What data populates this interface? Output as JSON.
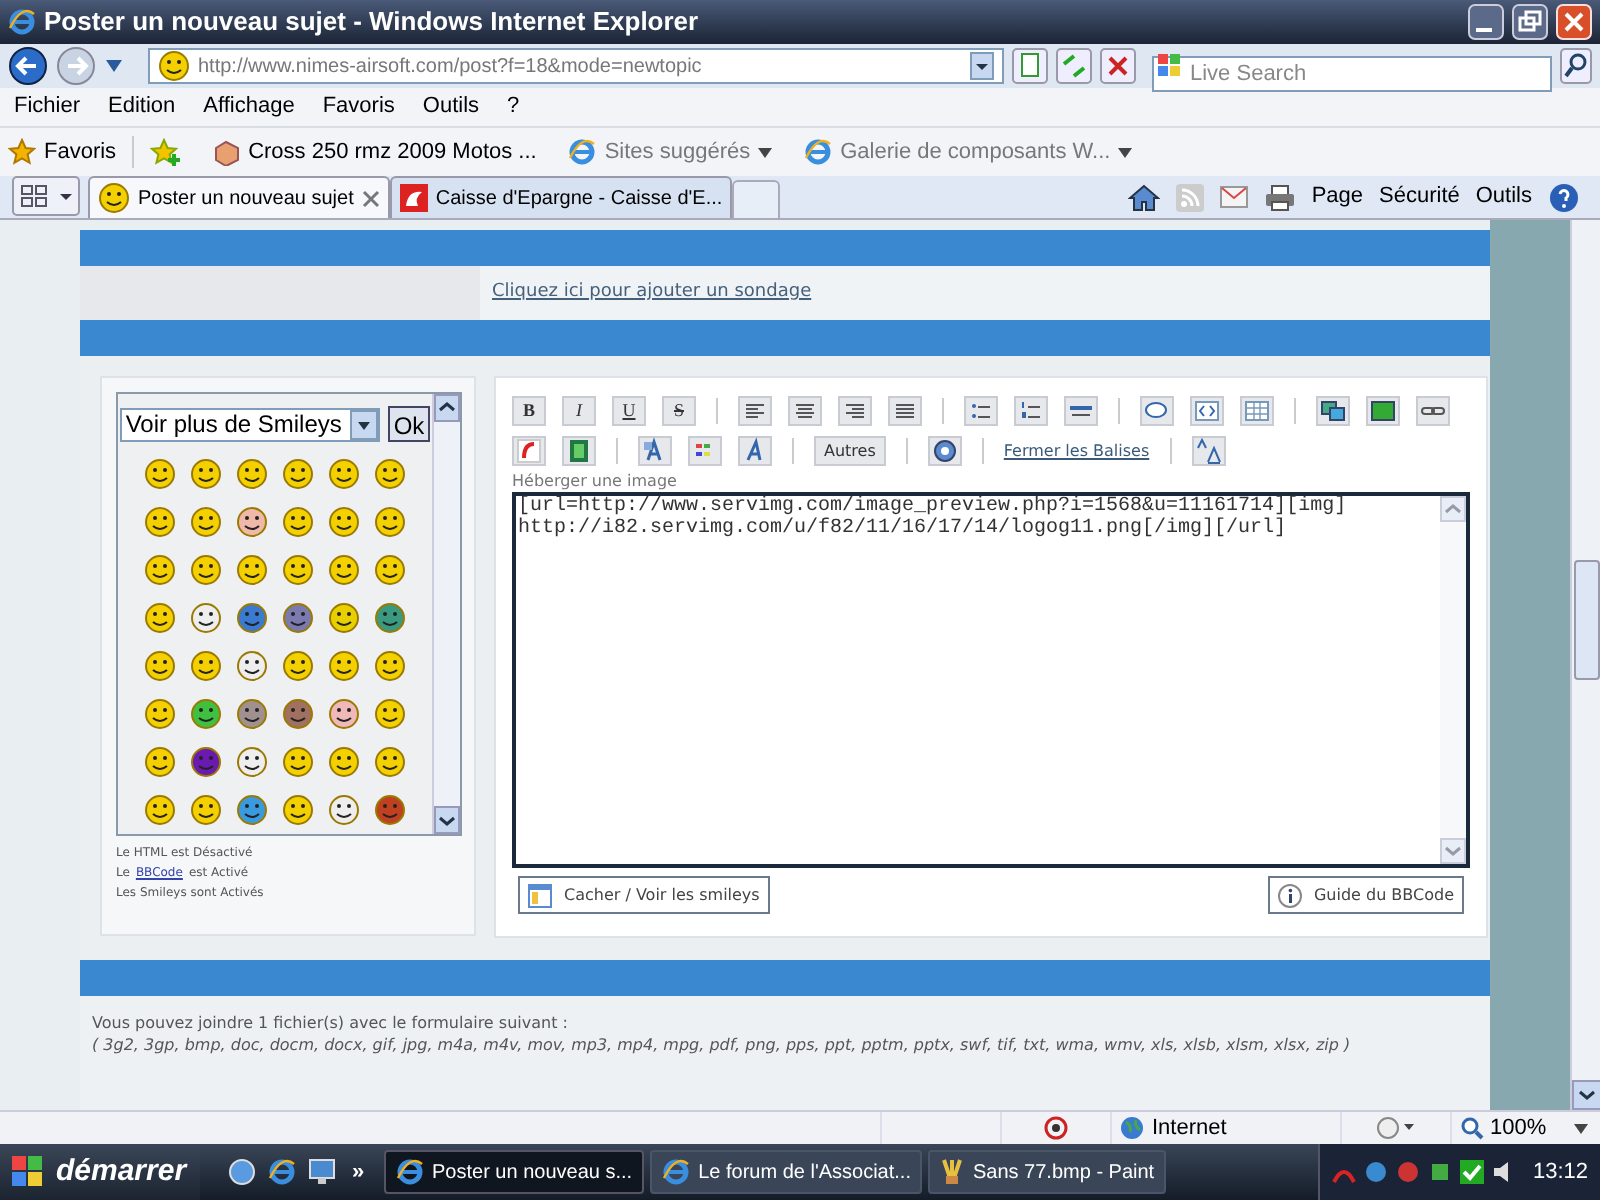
{
  "window": {
    "title": "Poster un nouveau sujet - Windows Internet Explorer"
  },
  "address_bar": {
    "url": "http://www.nimes-airsoft.com/post?f=18&mode=newtopic",
    "search_placeholder": "Live Search"
  },
  "menu": [
    "Fichier",
    "Edition",
    "Affichage",
    "Favoris",
    "Outils",
    "?"
  ],
  "favorites_bar": {
    "label": "Favoris",
    "items": [
      "Cross 250 rmz 2009 Motos ...",
      "Sites suggérés",
      "Galerie de composants W..."
    ]
  },
  "tabs": [
    {
      "label": "Poster un nouveau sujet",
      "selected": true
    },
    {
      "label": "Caisse d'Epargne - Caisse d'E...",
      "selected": false
    }
  ],
  "command_bar": [
    "Page",
    "Sécurité",
    "Outils"
  ],
  "page": {
    "poll_link": "Cliquez ici pour ajouter un sondage",
    "smileys": {
      "select": "Voir plus de Smileys",
      "ok": "Ok"
    },
    "notes": [
      {
        "before": "Le HTML est Désactivé"
      },
      {
        "before": "Le",
        "link": "BBCode",
        "after": "est Activé"
      },
      {
        "before": "Les Smileys sont Activés"
      }
    ],
    "toolbar": {
      "bold": "B",
      "italic": "I",
      "underline": "U",
      "strike": "S",
      "other_button": "Autres",
      "close_tags_link": "Fermer les Balises"
    },
    "host_image_label": "Héberger une image",
    "message": "[url=http://www.servimg.com/image_preview.php?i=1568&u=11161714][img]\nhttp://i82.servimg.com/u/f82/11/16/17/14/logog11.png[/img][/url]",
    "hide_smileys_button": "Cacher / Voir les smileys",
    "bbcode_guide_button": "Guide du BBCode",
    "attachments_text": "Vous pouvez joindre 1 fichier(s) avec le formulaire suivant :",
    "attachments_types": "( 3g2, 3gp, bmp, doc, docm, docx, gif, jpg, m4a, m4v, mov, mp3, mp4, mpg, pdf, png, pps, ppt, pptm, pptx, swf, tif, txt, wma, wmv, xls, xlsb, xlsm, xlsx, zip )"
  },
  "status_bar": {
    "zone": "Internet",
    "zoom": "100%"
  },
  "taskbar": {
    "start": "démarrer",
    "more": "»",
    "tasks": [
      {
        "label": "Poster un nouveau s...",
        "selected": true
      },
      {
        "label": "Le forum de l'Associat...",
        "selected": false
      },
      {
        "label": "Sans 77.bmp - Paint",
        "selected": false
      }
    ],
    "clock": "13:12"
  }
}
